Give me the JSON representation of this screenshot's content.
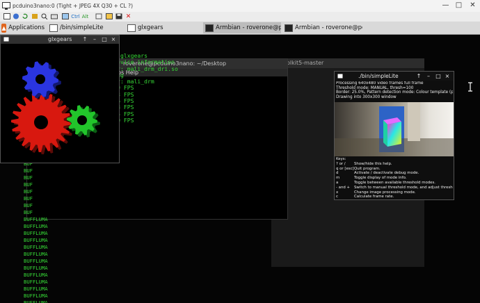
{
  "vnc": {
    "title": "pcduino3nano:0 (Tight + JPEG 4X Q30 + CL ?)",
    "toolbar_icons": [
      "options-icon",
      "info-icon",
      "refresh-icon",
      "toggle-icon",
      "zoom-icon",
      "ctrl-key-icon",
      "alt-key-icon",
      "key-icon",
      "transfer-icon",
      "save-icon",
      "close-icon"
    ],
    "toolbar_ctrl": "Ctrl",
    "toolbar_alt": "Alt"
  },
  "panel": {
    "apps_label": "Applications",
    "tasks": [
      "/bin/simpleLite",
      "glxgears",
      "Armbian - roverone@pc...",
      "Armbian - roverone@pc..."
    ]
  },
  "glxgears": {
    "title": "glxgears",
    "colors": {
      "red": "#d8180f",
      "green": "#22c52b",
      "blue": "#2a35e0"
    }
  },
  "terminal": {
    "title": "roverone@pcduino3nano: ~/Desktop",
    "menu_fragment": "ps   Help",
    "lines": [
      "esktop$ glxgears",
      "rieve device information",
      "d driver: mali_drm_dri.so",
      "  missing",
      "d driver: mali_drm",
      "= 23.539 FPS",
      "= 24.983 FPS",
      "= 32.146 FPS",
      "= 32.498 FPS",
      "= 32.165 FPS",
      "= 32.190 FPS"
    ],
    "buf_lines": [
      "BUF",
      "BUF",
      "BUF",
      "BUF",
      "BUF",
      "BUF",
      "BUF",
      "BUF",
      "BUF",
      "BUF",
      "BUFFLUMA",
      "BUFFLUMA",
      "BUFFLUMA",
      "BUFFLUMA",
      "BUFFLUMA",
      "BUFFLUMA",
      "BUFFLUMA",
      "BUFFLUMA",
      "BUFFLUMA",
      "BUFFLUMA",
      "BUFFLUMA",
      "BUFFLUMA",
      "BUFFLUMA"
    ]
  },
  "background_window": {
    "title_fragment": "olkit5-master"
  },
  "simplelite": {
    "title": "./bin/simpleLite",
    "header": [
      "Processing 640x480 video frames full frame",
      "Threshold mode: MANUAL, thresh=100",
      "Border: 25.0%, Pattern detection mode: Colour template (pattern)",
      "Drawing into 300x300 window"
    ],
    "keys_label": "Keys:",
    "keys": [
      [
        "? or /",
        "Show/hide this help."
      ],
      [
        "q or [esc]",
        "Quit program."
      ],
      [
        "d",
        "Activate / deactivate debug mode."
      ],
      [
        "m",
        "Toggle display of mode info."
      ],
      [
        "a",
        "Toggle between available threshold modes."
      ],
      [
        "- and +",
        "Switch to manual threshold mode, and adjust threshold"
      ],
      [
        "x",
        "Change image processing mode."
      ],
      [
        "c",
        "Calculate frame rate."
      ]
    ]
  }
}
